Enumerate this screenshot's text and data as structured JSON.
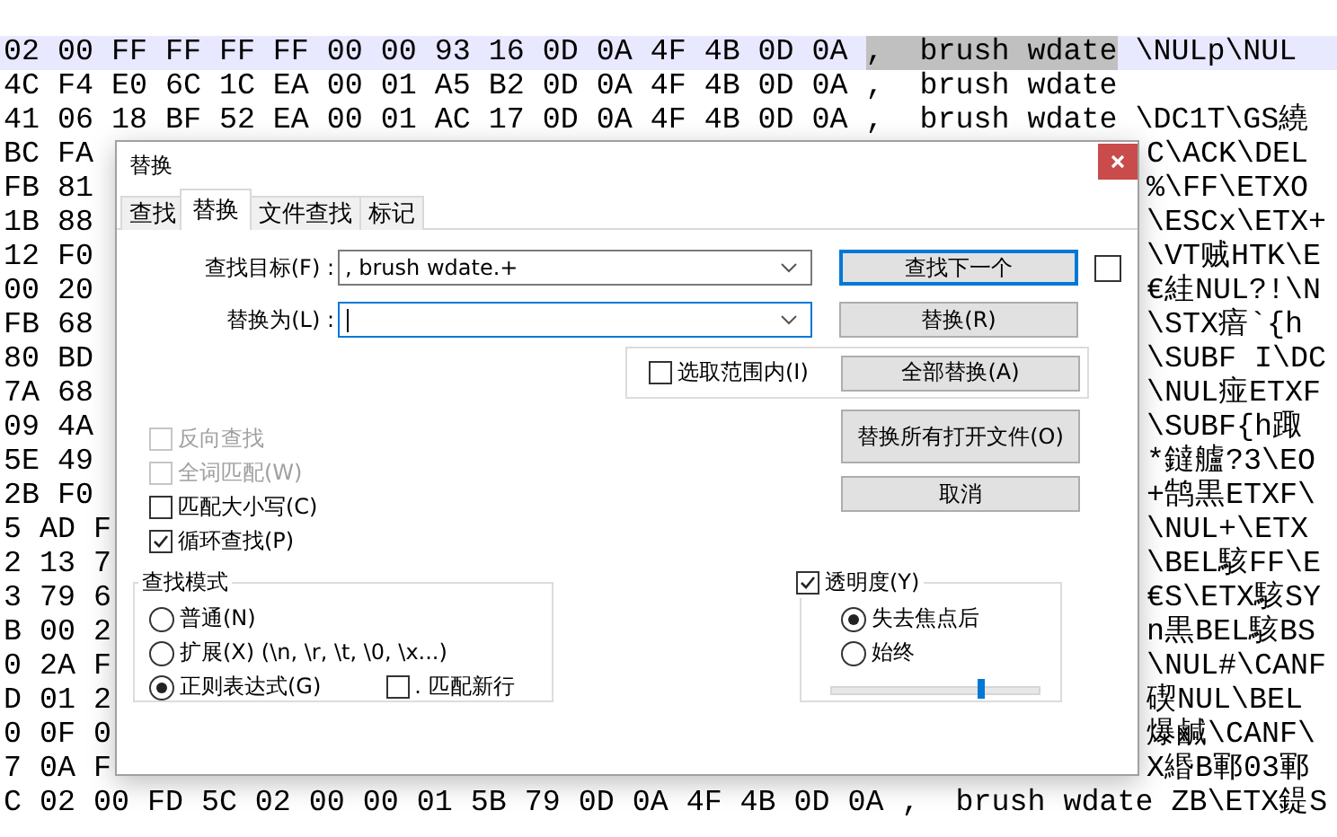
{
  "editor": {
    "rows": [
      {
        "kind": "full",
        "current": true,
        "segments": [
          {
            "text": "02 00 FF FF FF FF 00 00 93 16 0D 0A 4F 4B 0D 0A ",
            "selected": false
          },
          {
            "text": ",  brush wdate",
            "selected": true
          },
          {
            "text": " \\NULp\\NUL",
            "selected": false
          }
        ]
      },
      {
        "kind": "full",
        "current": false,
        "segments": [
          {
            "text": "4C F4 E0 6C 1C EA 00 01 A5 B2 0D 0A 4F 4B 0D 0A ,  brush wdate",
            "selected": false
          }
        ]
      },
      {
        "kind": "full",
        "current": false,
        "segments": [
          {
            "text": "41 06 18 BF 52 EA 00 01 AC 17 0D 0A 4F 4B 0D 0A ,  brush wdate \\DC1T\\GS繞",
            "selected": false
          }
        ]
      },
      {
        "kind": "split",
        "current": false,
        "left": "BC FA",
        "right": "C\\ACK\\DEL"
      },
      {
        "kind": "split",
        "current": false,
        "left": "FB 81",
        "right": "%\\FF\\ETXO"
      },
      {
        "kind": "split",
        "current": false,
        "left": "1B 88",
        "right": "\\ESCx\\ETX+"
      },
      {
        "kind": "split",
        "current": false,
        "left": "12 F0",
        "right": "\\VT贼HTK\\E"
      },
      {
        "kind": "split",
        "current": false,
        "left": "00 20",
        "right": "€絓NUL?!\\N"
      },
      {
        "kind": "split",
        "current": false,
        "left": "FB 68",
        "right": "\\STX瘖`{h"
      },
      {
        "kind": "split",
        "current": false,
        "left": "80 BD",
        "right": "\\SUBF I\\DC"
      },
      {
        "kind": "split",
        "current": false,
        "left": "7A 68",
        "right": "\\NUL痖ETXF"
      },
      {
        "kind": "split",
        "current": false,
        "left": "09 4A",
        "right": "\\SUBF{h踙"
      },
      {
        "kind": "split",
        "current": false,
        "left": "5E 49",
        "right": "*鐽艫?3\\EO"
      },
      {
        "kind": "split",
        "current": false,
        "left": "2B F0",
        "right": "+鹄黒ETXF\\"
      },
      {
        "kind": "split",
        "current": false,
        "left": "5 AD F",
        "right": "\\NUL+\\ETX"
      },
      {
        "kind": "split",
        "current": false,
        "left": "2 13 7",
        "right": "\\BEL駭FF\\E"
      },
      {
        "kind": "split",
        "current": false,
        "left": "3 79 6",
        "right": "€S\\ETX駭SY"
      },
      {
        "kind": "split",
        "current": false,
        "left": "B 00 2",
        "right": "n黒BEL駭BS"
      },
      {
        "kind": "split",
        "current": false,
        "left": "0 2A F",
        "right": "\\NUL#\\CANF"
      },
      {
        "kind": "split",
        "current": false,
        "left": "D 01 2",
        "right": "碶NUL\\BEL"
      },
      {
        "kind": "split",
        "current": false,
        "left": "0 0F 0",
        "right": "爆鹹\\CANF\\"
      },
      {
        "kind": "split",
        "current": false,
        "left": "7 0A F",
        "right": "X緡B鄆03鄆"
      },
      {
        "kind": "full",
        "current": false,
        "segments": [
          {
            "text": "C 02 00 FD 5C 02 00 00 01 5B 79 0D 0A 4F 4B 0D 0A ,  brush wdate ZB\\ETX鍉S",
            "selected": false
          }
        ]
      }
    ]
  },
  "dialog": {
    "title": "替换",
    "tabs": [
      {
        "label": "查找",
        "selected": false
      },
      {
        "label": "替换",
        "selected": true
      },
      {
        "label": "文件查找",
        "selected": false
      },
      {
        "label": "标记",
        "selected": false
      }
    ],
    "find": {
      "label": "查找目标(F) :",
      "value": ", brush wdate.+",
      "focused": false
    },
    "replace": {
      "label": "替换为(L) :",
      "focused": true
    },
    "find_next": {
      "label": "查找下一个",
      "default": true
    },
    "side_checkbox": {
      "checked": false
    },
    "replace_button": {
      "label": "替换(R)",
      "default": false
    },
    "in_selection": {
      "label": "选取范围内(I)",
      "checked": false,
      "disabled": false
    },
    "replace_all": {
      "label": "全部替换(A)",
      "default": false
    },
    "options": [
      {
        "label": "反向查找",
        "checked": false,
        "disabled": true
      },
      {
        "label": "全词匹配(W)",
        "checked": false,
        "disabled": true
      },
      {
        "label": "匹配大小写(C)",
        "checked": false,
        "disabled": false
      },
      {
        "label": "循环查找(P)",
        "checked": true,
        "disabled": false
      }
    ],
    "replace_all_open": {
      "label": "替换所有打开文件(O)",
      "default": false
    },
    "cancel": {
      "label": "取消",
      "default": false
    },
    "search_mode": {
      "title": "查找模式",
      "modes": [
        {
          "label": "普通(N)",
          "selected": false
        },
        {
          "label": "扩展(X) (\\n, \\r, \\t, \\0, \\x...)",
          "selected": false
        },
        {
          "label": "正则表达式(G)",
          "selected": true
        }
      ],
      "dot_newline": {
        "label": ". 匹配新行",
        "checked": false,
        "disabled": false
      }
    },
    "transparency": {
      "label": "透明度(Y)",
      "checked": true,
      "disabled": false,
      "modes": [
        {
          "label": "失去焦点后",
          "selected": true
        },
        {
          "label": "始终",
          "selected": false
        }
      ],
      "level": 0.72
    }
  }
}
